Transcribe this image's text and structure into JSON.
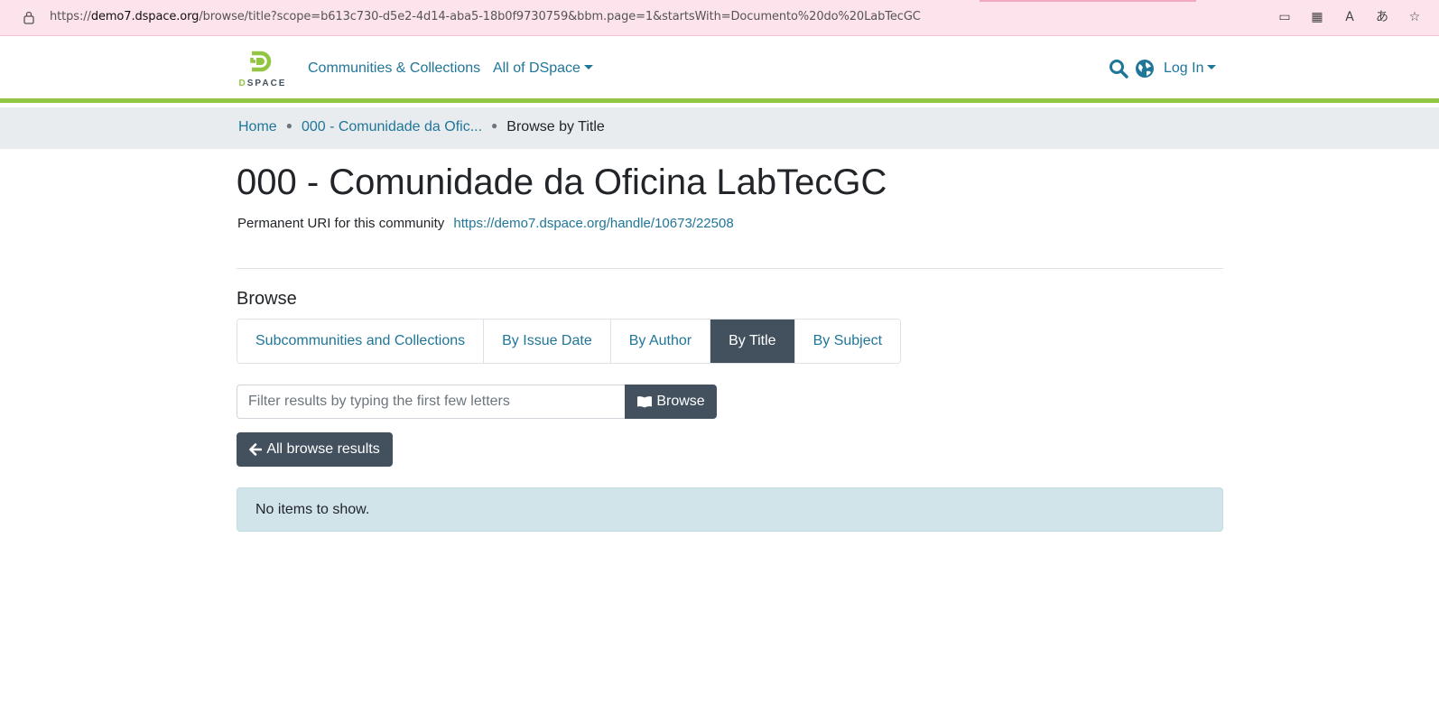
{
  "browser": {
    "url_prefix": "https://",
    "url_host": "demo7.dspace.org",
    "url_path": "/browse/title?scope=b613c730-d5e2-4d14-aba5-18b0f9730759&bbm.page=1&startsWith=Documento%20do%20LabTecGC"
  },
  "navbar": {
    "logo_text_d": "D",
    "logo_text_rest": "SPACE",
    "communities_label": "Communities & Collections",
    "all_of_dspace_label": "All of DSpace",
    "login_label": "Log In"
  },
  "breadcrumb": {
    "home": "Home",
    "community": "000 - Comunidade da Ofic...",
    "current": "Browse by Title"
  },
  "main": {
    "title": "000 - Comunidade da Oficina LabTecGC",
    "uri_label": "Permanent URI for this community",
    "uri_value": "https://demo7.dspace.org/handle/10673/22508",
    "browse_heading": "Browse",
    "tabs": [
      {
        "label": "Subcommunities and Collections",
        "active": false
      },
      {
        "label": "By Issue Date",
        "active": false
      },
      {
        "label": "By Author",
        "active": false
      },
      {
        "label": "By Title",
        "active": true
      },
      {
        "label": "By Subject",
        "active": false
      }
    ],
    "filter_placeholder": "Filter results by typing the first few letters",
    "browse_button": "Browse",
    "all_results_button": "All browse results",
    "empty_message": "No items to show."
  },
  "colors": {
    "primary": "#43515f",
    "link": "#207698",
    "accent_green": "#92c642",
    "info_bg": "#d1e4ea"
  },
  "icons": [
    "lock-icon",
    "search-icon",
    "globe-icon",
    "book-icon",
    "arrow-left-icon",
    "caret-down-icon"
  ]
}
